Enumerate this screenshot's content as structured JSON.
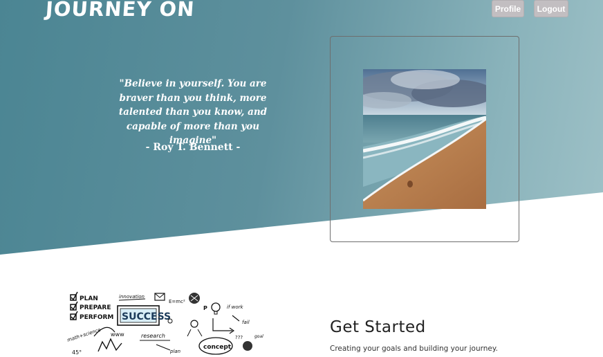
{
  "header": {
    "brand": "JOURNEY ON",
    "profile_label": "Profile",
    "logout_label": "Logout"
  },
  "hero": {
    "quote": "\"Believe in yourself. You are braver than you think, more talented than you know, and capable of more than you imagine\"",
    "author": "- Roy T. Bennett -"
  },
  "sketch_words": {
    "plan": "PLAN",
    "prepare": "PREPARE",
    "perform": "PERFORM",
    "success": "SUCCESS",
    "innovation": "innovation",
    "research": "research",
    "concept": "concept",
    "goal": "goal",
    "math_science": "math+science",
    "if_work": "if work",
    "fail": "fail",
    "plan_small": "plan"
  },
  "get_started": {
    "title": "Get Started",
    "subtitle": "Creating your goals and building your journey."
  },
  "colors": {
    "hero_start": "#4b8593",
    "hero_end": "#9ec1c7",
    "button_bg": "#c2bec1"
  }
}
